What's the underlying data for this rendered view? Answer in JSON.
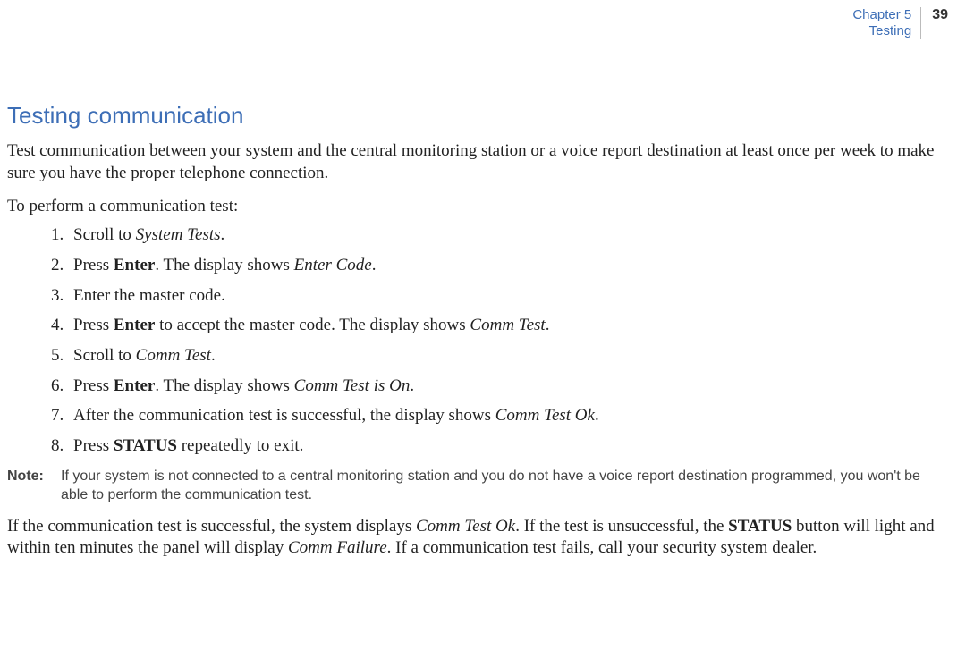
{
  "header": {
    "chapter_line1": "Chapter 5",
    "chapter_line2": "Testing",
    "page_number": "39"
  },
  "section_title": "Testing communication",
  "intro": "Test communication between your system and the central monitoring station or a voice report destination at least once per week to make sure you have the proper telephone connection.",
  "lead": "To perform a communication test:",
  "steps": {
    "s1_a": "Scroll to ",
    "s1_i": "System Tests",
    "s1_b": ".",
    "s2_a": "Press ",
    "s2_bold": "Enter",
    "s2_b": ". The display shows ",
    "s2_i": "Enter Code",
    "s2_c": ".",
    "s3": "Enter the master code.",
    "s4_a": "Press ",
    "s4_bold": "Enter",
    "s4_b": " to accept the master code. The display shows ",
    "s4_i": "Comm Test",
    "s4_c": ".",
    "s5_a": "Scroll to ",
    "s5_i": "Comm Test",
    "s5_b": ".",
    "s6_a": "Press ",
    "s6_bold": "Enter",
    "s6_b": ". The display shows ",
    "s6_i": "Comm Test is On",
    "s6_c": ".",
    "s7_a": "After the communication test is successful, the display shows ",
    "s7_i": "Comm Test Ok",
    "s7_b": ".",
    "s8_a": "Press ",
    "s8_bold": "STATUS",
    "s8_b": " repeatedly to exit."
  },
  "note": {
    "label": "Note:",
    "text": "If your system is not connected to a central monitoring station and you do not have a voice report destination programmed, you won't be able to perform the communication test."
  },
  "footer": {
    "a": "If the communication test is successful, the system displays ",
    "i1": "Comm Test Ok",
    "b": ". If the test is unsuccessful, the ",
    "bold": "STATUS",
    "c": " button will light and within ten minutes the panel will display ",
    "i2": "Comm Failure",
    "d": ". If a communication test fails, call your security system dealer."
  }
}
